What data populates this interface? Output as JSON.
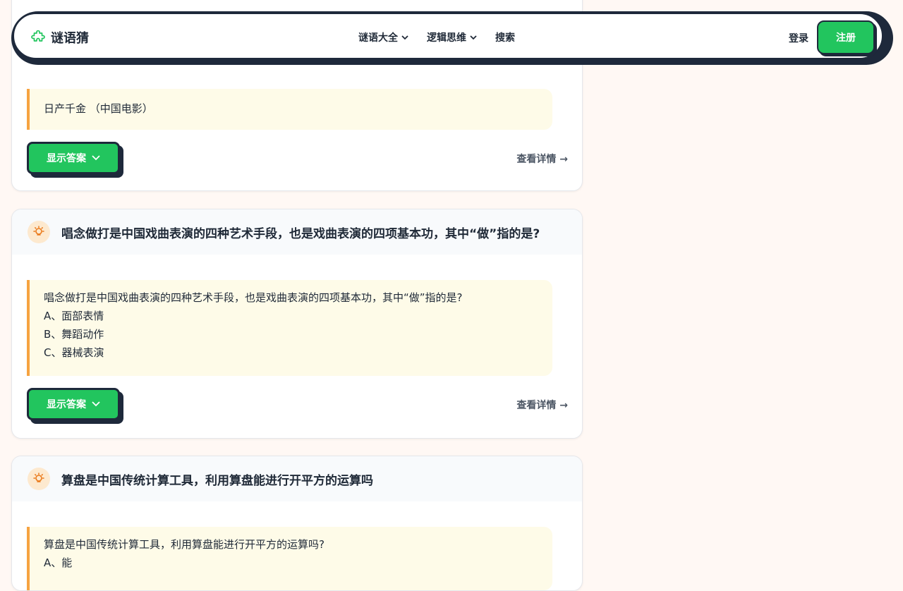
{
  "nav": {
    "brand": "谜语猜",
    "menu": [
      {
        "label": "谜语大全",
        "has_dropdown": true
      },
      {
        "label": "逻辑思维",
        "has_dropdown": true
      },
      {
        "label": "搜索",
        "has_dropdown": false
      }
    ],
    "login": "登录",
    "register": "注册"
  },
  "cards": [
    {
      "title": "",
      "lines": [
        "日产千金 （中国电影）"
      ],
      "answer_button": "显示答案",
      "detail_link": "查看详情 →"
    },
    {
      "title": "唱念做打是中国戏曲表演的四种艺术手段，也是戏曲表演的四项基本功，其中“做”指的是?",
      "lines": [
        "唱念做打是中国戏曲表演的四种艺术手段，也是戏曲表演的四项基本功，其中“做”指的是?",
        "A、面部表情",
        "B、舞蹈动作",
        "C、器械表演"
      ],
      "answer_button": "显示答案",
      "detail_link": "查看详情 →"
    },
    {
      "title": "算盘是中国传统计算工具，利用算盘能进行开平方的运算吗",
      "lines": [
        "算盘是中国传统计算工具，利用算盘能进行开平方的运算吗?",
        "A、能"
      ]
    }
  ],
  "colors": {
    "accent_green": "#22c55e",
    "outline_dark": "#1e293b",
    "quote_bar": "#f6a341",
    "quote_bg": "#fefbe8",
    "page_bg": "#fff8f4"
  }
}
